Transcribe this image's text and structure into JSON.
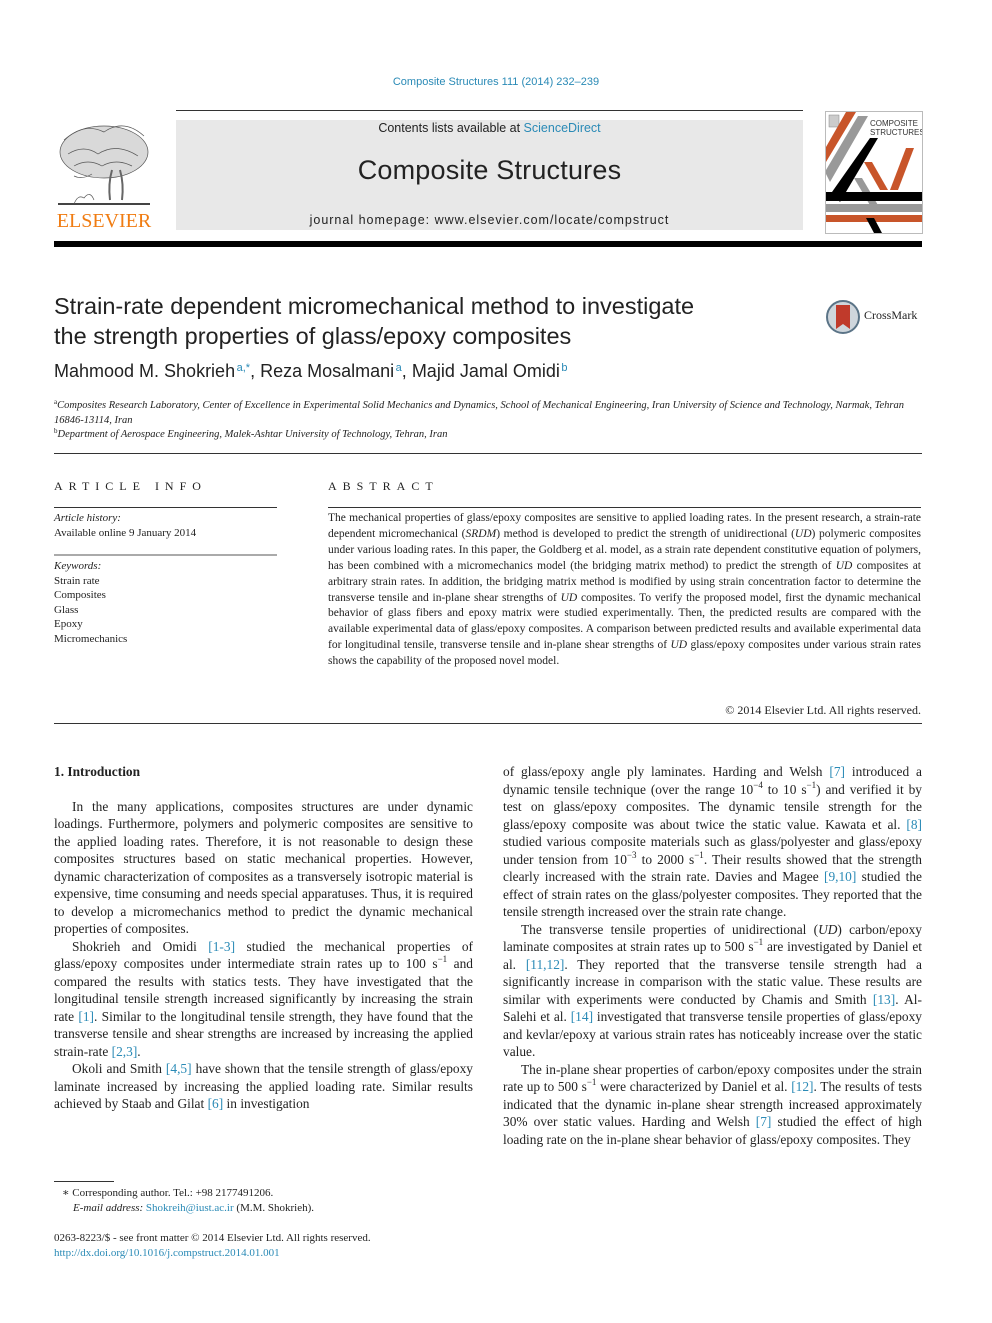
{
  "header": {
    "citation": "Composite Structures 111 (2014) 232–239",
    "contents_prefix": "Contents lists available at ",
    "contents_link": "ScienceDirect",
    "journal_title": "Composite Structures",
    "homepage": "journal homepage: www.elsevier.com/locate/compstruct",
    "publisher_logo_text": "ELSEVIER",
    "cover_text_line1": "COMPOSITE",
    "cover_text_line2": "STRUCTURES"
  },
  "article": {
    "title_line1": "Strain-rate dependent micromechanical method to investigate",
    "title_line2": "the strength properties of glass/epoxy composites",
    "crossmark_label": "CrossMark",
    "authors": [
      {
        "name": "Mahmood M. Shokrieh",
        "sup": "a,*"
      },
      {
        "name": "Reza Mosalmani",
        "sup": "a"
      },
      {
        "name": "Majid Jamal Omidi",
        "sup": "b"
      }
    ],
    "affiliations": [
      {
        "sup": "a",
        "text": "Composites Research Laboratory, Center of Excellence in Experimental Solid Mechanics and Dynamics, School of Mechanical Engineering, Iran University of Science and Technology, Narmak, Tehran 16846-13114, Iran"
      },
      {
        "sup": "b",
        "text": "Department of Aerospace Engineering, Malek-Ashtar University of Technology, Tehran, Iran"
      }
    ]
  },
  "article_info": {
    "heading": "ARTICLE INFO",
    "history_label": "Article history:",
    "history_value": "Available online 9 January 2014",
    "keywords_label": "Keywords:",
    "keywords": [
      "Strain rate",
      "Composites",
      "Glass",
      "Epoxy",
      "Micromechanics"
    ]
  },
  "abstract": {
    "heading": "ABSTRACT",
    "text": "The mechanical properties of glass/epoxy composites are sensitive to applied loading rates. In the present research, a strain-rate dependent micromechanical (SRDM) method is developed to predict the strength of unidirectional (UD) polymeric composites under various loading rates. In this paper, the Goldberg et al. model, as a strain rate dependent constitutive equation of polymers, has been combined with a micromechanics model (the bridging matrix method) to predict the strength of UD composites at arbitrary strain rates. In addition, the bridging matrix method is modified by using strain concentration factor to determine the transverse tensile and in-plane shear strengths of UD composites. To verify the proposed model, first the dynamic mechanical behavior of glass fibers and epoxy matrix were studied experimentally. Then, the predicted results are compared with the available experimental data of glass/epoxy composites. A comparison between predicted results and available experimental data for longitudinal tensile, transverse tensile and in-plane shear strengths of UD glass/epoxy composites under various strain rates shows the capability of the proposed novel model.",
    "copyright": "© 2014 Elsevier Ltd. All rights reserved."
  },
  "body": {
    "section_heading": "1. Introduction",
    "left_paragraphs": [
      "In the many applications, composites structures are under dynamic loadings. Furthermore, polymers and polymeric composites are sensitive to the applied loading rates. Therefore, it is not reasonable to design these composites structures based on static mechanical properties. However, dynamic characterization of composites as a transversely isotropic material is expensive, time consuming and needs special apparatuses. Thus, it is required to develop a micromechanics method to predict the dynamic mechanical properties of composites."
    ],
    "p2": {
      "a": "Shokrieh and Omidi ",
      "ref1": "[1-3]",
      "b": " studied the mechanical properties of glass/epoxy composites under intermediate strain rates up to 100 s",
      "b_sup": "−1",
      "c": " and compared the results with statics tests. They have investigated that the longitudinal tensile strength increased significantly by increasing the strain rate ",
      "ref2": "[1]",
      "d": ". Similar to the longitudinal tensile strength, they have found that the transverse tensile and shear strengths are increased by increasing the applied strain-rate ",
      "ref3": "[2,3]",
      "e": "."
    },
    "p3": {
      "a": "Okoli and Smith ",
      "ref1": "[4,5]",
      "b": " have shown that the tensile strength of glass/epoxy laminate increased by increasing the applied loading rate. Similar results achieved by Staab and Gilat ",
      "ref2": "[6]",
      "c": " in investigation"
    },
    "p4": {
      "a": "of glass/epoxy angle ply laminates. Harding and Welsh ",
      "ref1": "[7]",
      "b": " introduced a dynamic tensile technique (over the range 10",
      "sup1": "−4",
      "c": " to 10 s",
      "sup2": "−1",
      "d": ") and verified it by test on glass/epoxy composites. The dynamic tensile strength for the glass/epoxy composite was about twice the static value. Kawata et al. ",
      "ref2": "[8]",
      "e": " studied various composite materials such as glass/polyester and glass/epoxy under tension from 10",
      "sup3": "−3",
      "f": " to 2000 s",
      "sup4": "−1",
      "g": ". Their results showed that the strength clearly increased with the strain rate. Davies and Magee ",
      "ref3": "[9,10]",
      "h": " studied the effect of strain rates on the glass/polyester composites. They reported that the tensile strength increased over the strain rate change."
    },
    "p5": {
      "a": "The transverse tensile properties of unidirectional (",
      "ud": "UD",
      "b": ") carbon/epoxy laminate composites at strain rates up to 500 s",
      "sup1": "−1",
      "c": " are investigated by Daniel et al. ",
      "ref1": "[11,12]",
      "d": ". They reported that the transverse tensile strength had a significantly increase in comparison with the static value. These results are similar with experiments were conducted by Chamis and Smith ",
      "ref2": "[13]",
      "e": ". Al-Salehi et al. ",
      "ref3": "[14]",
      "f": " investigated that transverse tensile properties of glass/epoxy and kevlar/epoxy at various strain rates has noticeably increase over the static value."
    },
    "p6": {
      "a": "The in-plane shear properties of carbon/epoxy composites under the strain rate up to 500 s",
      "sup1": "−1",
      "b": " were characterized by Daniel et al. ",
      "ref1": "[12]",
      "c": ". The results of tests indicated that the dynamic in-plane shear strength increased approximately 30% over static values. Harding and Welsh ",
      "ref2": "[7]",
      "d": " studied the effect of high loading rate on the in-plane shear behavior of glass/epoxy composites. They"
    }
  },
  "footnotes": {
    "corresponding": "∗ Corresponding author. Tel.: +98 2177491206.",
    "email_label": "E-mail address: ",
    "email": "Shokreih@iust.ac.ir",
    "email_suffix": " (M.M. Shokrieh).",
    "front_matter": "0263-8223/$ - see front matter © 2014 Elsevier Ltd. All rights reserved.",
    "doi": "http://dx.doi.org/10.1016/j.compstruct.2014.01.001"
  },
  "colors": {
    "link": "#2a8ab6",
    "elsevier_orange": "#f07c12",
    "cover_orange": "#c8552a"
  }
}
